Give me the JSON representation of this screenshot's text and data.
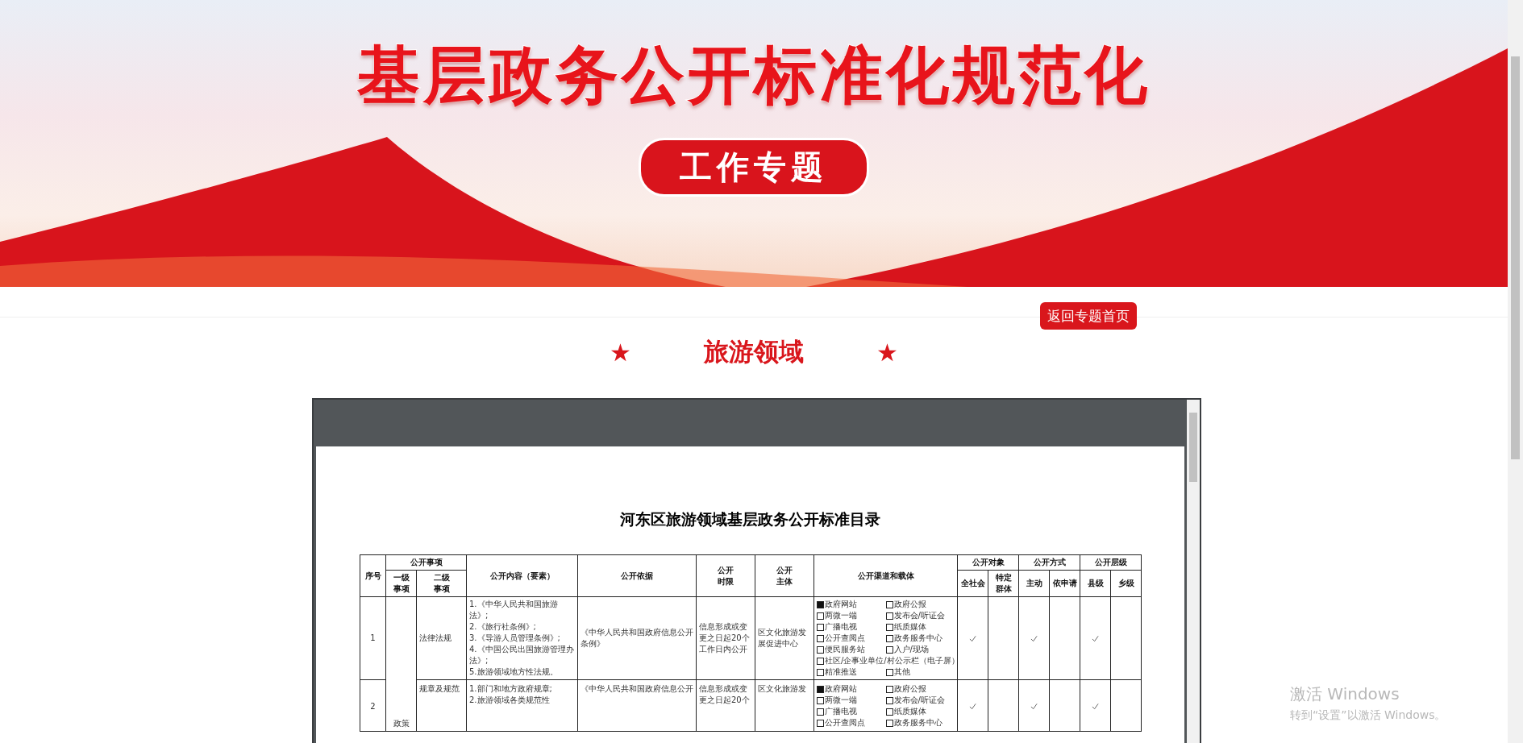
{
  "banner": {
    "title": "基层政务公开标准化规范化",
    "subtitle": "工作专题"
  },
  "back_button": "返回专题首页",
  "section_title": {
    "star_left": "★",
    "text": "旅游领域",
    "star_right": "★"
  },
  "document": {
    "title": "河东区旅游领域基层政务公开标准目录",
    "table": {
      "header": {
        "number": "序号",
        "items": "公开事项",
        "level_1": "一级事项",
        "level_2": "二级事项",
        "content": "公开内容（要素）",
        "basis": "公开依据",
        "time_limit": "公开时限",
        "subject": "公开主体",
        "channels": "公开渠道和载体",
        "audience": "公开对象",
        "audience_all": "全社会",
        "audience_specific": "特定群体",
        "mode": "公开方式",
        "mode_active": "主动",
        "mode_request": "依申请",
        "level": "公开层级",
        "level_county": "县级",
        "level_town": "乡级"
      },
      "groups": [
        {
          "level_1": "政策",
          "rows": [
            {
              "number": "1",
              "level_2": "法律法规",
              "content": "1.《中华人民共和国旅游法》;\n2.《旅行社条例》;\n3.《导游人员管理条例》;\n4.《中国公民出国旅游管理办法》;\n5.旅游领域地方性法规。",
              "basis": "《中华人民共和国政府信息公开条例》",
              "time_limit": "信息形成或变更之日起20个工作日内公开",
              "subject": "区文化旅游发展促进中心",
              "channels": [
                {
                  "label": "政府网站",
                  "checked": true,
                  "kind": "half"
                },
                {
                  "label": "政府公报",
                  "checked": false,
                  "kind": "half"
                },
                {
                  "label": "两微一端",
                  "checked": false,
                  "kind": "half"
                },
                {
                  "label": "发布会/听证会",
                  "checked": false,
                  "kind": "half"
                },
                {
                  "label": "广播电视",
                  "checked": false,
                  "kind": "half"
                },
                {
                  "label": "纸质媒体",
                  "checked": false,
                  "kind": "half"
                },
                {
                  "label": "公开查阅点",
                  "checked": false,
                  "kind": "half"
                },
                {
                  "label": "政务服务中心",
                  "checked": false,
                  "kind": "half"
                },
                {
                  "label": "便民服务站",
                  "checked": false,
                  "kind": "half"
                },
                {
                  "label": "入户/现场",
                  "checked": false,
                  "kind": "half"
                },
                {
                  "label": "社区/企事业单位/村公示栏（电子屏）",
                  "checked": false,
                  "kind": "wide"
                },
                {
                  "label": "精准推送",
                  "checked": false,
                  "kind": "half"
                },
                {
                  "label": "其他",
                  "checked": false,
                  "kind": "half"
                }
              ],
              "audience_all": true,
              "audience_specific": false,
              "mode_active": true,
              "mode_request": false,
              "level_county": true,
              "level_town": false
            },
            {
              "number": "2",
              "level_2": "规章及规范",
              "content": "1.部门和地方政府规章;\n2.旅游领域各类规范性",
              "basis": "《中华人民共和国政府信息公开",
              "time_limit": "信息形成或变更之日起20个",
              "subject": "区文化旅游发",
              "channels": [
                {
                  "label": "政府网站",
                  "checked": true,
                  "kind": "half"
                },
                {
                  "label": "政府公报",
                  "checked": false,
                  "kind": "half"
                },
                {
                  "label": "两微一端",
                  "checked": false,
                  "kind": "half"
                },
                {
                  "label": "发布会/听证会",
                  "checked": false,
                  "kind": "half"
                },
                {
                  "label": "广播电视",
                  "checked": false,
                  "kind": "half"
                },
                {
                  "label": "纸质媒体",
                  "checked": false,
                  "kind": "half"
                },
                {
                  "label": "公开查阅点",
                  "checked": false,
                  "kind": "half"
                },
                {
                  "label": "政务服务中心",
                  "checked": false,
                  "kind": "half"
                }
              ],
              "audience_all": true,
              "audience_specific": false,
              "mode_active": true,
              "mode_request": false,
              "level_county": true,
              "level_town": false
            }
          ]
        }
      ]
    }
  },
  "os_notice": {
    "title": "激活 Windows",
    "text": "转到“设置”以激活 Windows。"
  }
}
